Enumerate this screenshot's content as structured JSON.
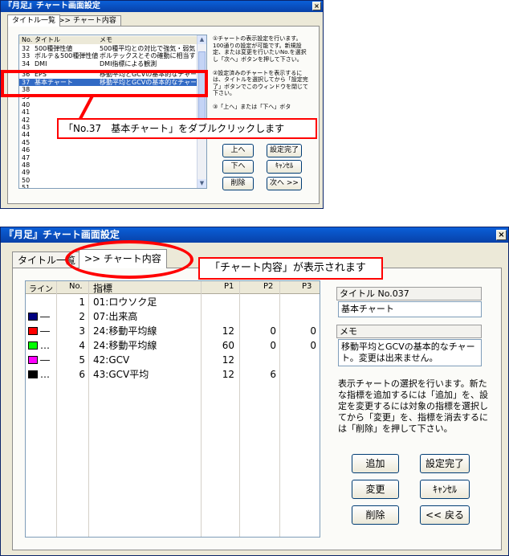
{
  "window_title": "『月足』チャート画面設定",
  "top": {
    "tabs": [
      "タイトル一覧",
      ">> チャート内容"
    ],
    "columns": [
      "No.",
      "タイトル",
      "メモ"
    ],
    "rows": [
      {
        "no": "32",
        "title": "500種弾性値",
        "memo": "500種平均との対比で強気・弱気を",
        "selected": false
      },
      {
        "no": "33",
        "title": "ボルテ＆500種弾性値",
        "memo": "ボルテックスとその確動に相当する",
        "selected": false
      },
      {
        "no": "34",
        "title": "DMI",
        "memo": "DMI指標による観測",
        "selected": false
      },
      {
        "no": "36",
        "title": "EPS",
        "memo": "移動平均とGCVの基本的なチャー",
        "selected": false
      },
      {
        "no": "37",
        "title": "基本チャート",
        "memo": "移動平均とGCVの基本的なチャー",
        "selected": true
      },
      {
        "no": "38",
        "title": "",
        "memo": "",
        "selected": false
      },
      {
        "no": "39",
        "title": "",
        "memo": "",
        "selected": false
      },
      {
        "no": "40",
        "title": "",
        "memo": "",
        "selected": false
      },
      {
        "no": "41",
        "title": "",
        "memo": "",
        "selected": false
      },
      {
        "no": "42",
        "title": "",
        "memo": "",
        "selected": false
      },
      {
        "no": "43",
        "title": "",
        "memo": "",
        "selected": false
      },
      {
        "no": "44",
        "title": "",
        "memo": "",
        "selected": false
      },
      {
        "no": "45",
        "title": "",
        "memo": "",
        "selected": false
      },
      {
        "no": "46",
        "title": "",
        "memo": "",
        "selected": false
      },
      {
        "no": "47",
        "title": "",
        "memo": "",
        "selected": false
      },
      {
        "no": "48",
        "title": "",
        "memo": "",
        "selected": false
      },
      {
        "no": "49",
        "title": "",
        "memo": "",
        "selected": false
      },
      {
        "no": "50",
        "title": "",
        "memo": "",
        "selected": false
      },
      {
        "no": "51",
        "title": "",
        "memo": "",
        "selected": false
      }
    ],
    "instructions": "①チャートの表示設定を行います。100通りの設定が可能です。新規設定、または変更を行いたいNo.を選択し「次へ」ボタンを押して下さい。\n\n②設定済みのチャートを表示するには、タイトルを選択してから「設定完了」ボタンでこのウィンドウを閉じて下さい。\n\n③「上へ」または「下へ」ボタ",
    "buttons": {
      "up": "上へ",
      "down": "下へ",
      "delete": "削除",
      "done": "設定完了",
      "cancel": "ｷｬﾝｾﾙ",
      "next": "次へ >>"
    },
    "callout": "「No.37　基本チャート」をダブルクリックします"
  },
  "bottom": {
    "tabs": [
      "タイトル一覧",
      ">> チャート内容"
    ],
    "callout": "「チャート内容」が表示されます",
    "columns": [
      "ライン",
      "No.",
      "指標",
      "P1",
      "P2",
      "P3"
    ],
    "rows": [
      {
        "color": "",
        "line": "",
        "no": "1",
        "indicator": "01:ロウソク足",
        "p1": "",
        "p2": "",
        "p3": ""
      },
      {
        "color": "#000080",
        "line": "―",
        "no": "2",
        "indicator": "07:出来高",
        "p1": "",
        "p2": "",
        "p3": ""
      },
      {
        "color": "#ff0000",
        "line": "―",
        "no": "3",
        "indicator": "24:移動平均線",
        "p1": "12",
        "p2": "0",
        "p3": "0"
      },
      {
        "color": "#00ff00",
        "line": "…",
        "no": "4",
        "indicator": "24:移動平均線",
        "p1": "60",
        "p2": "0",
        "p3": "0"
      },
      {
        "color": "#ff00ff",
        "line": "―",
        "no": "5",
        "indicator": "42:GCV",
        "p1": "12",
        "p2": "",
        "p3": ""
      },
      {
        "color": "#000000",
        "line": "…",
        "no": "6",
        "indicator": "43:GCV平均",
        "p1": "12",
        "p2": "6",
        "p3": ""
      }
    ],
    "title_label": "タイトル No.037",
    "title_value": "基本チャート",
    "memo_label": "メモ",
    "memo_value": "移動平均とGCVの基本的なチャート。変更は出来ません。",
    "instructions": "表示チャートの選択を行います。新たな指標を追加するには「追加」を、設定を変更するには対象の指標を選択してから「変更」を、指標を消去するには「削除」を押して下さい。",
    "buttons": {
      "add": "追加",
      "done": "設定完了",
      "change": "変更",
      "cancel": "ｷｬﾝｾﾙ",
      "delete": "削除",
      "back": "<< 戻る"
    }
  },
  "colors": {
    "highlight": "#ff0000",
    "selection": "#316ac5",
    "titlebar": "#0a5fd8"
  }
}
